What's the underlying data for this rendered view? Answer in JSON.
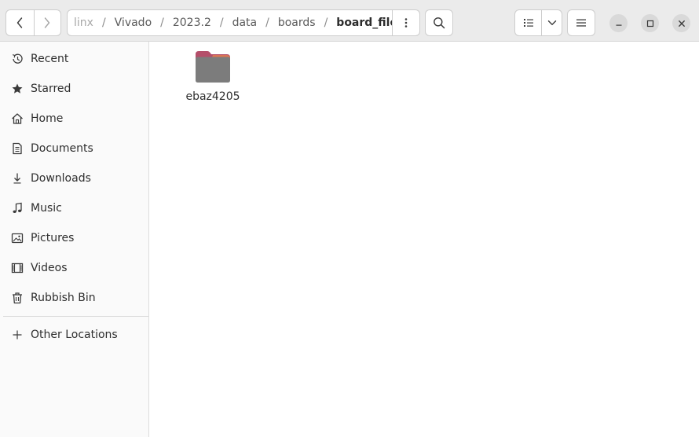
{
  "toolbar": {
    "back_icon": "chevron-left-icon",
    "forward_icon": "chevron-right-icon",
    "search_icon": "search-icon",
    "list_view_icon": "list-view-icon",
    "view_options_icon": "chevron-down-icon",
    "menu_icon": "hamburger-menu-icon",
    "path_menu_icon": "vertical-dots-icon"
  },
  "pathbar": {
    "crumbs": [
      {
        "label": "linx",
        "state": "faded"
      },
      {
        "label": "Vivado",
        "state": "normal"
      },
      {
        "label": "2023.2",
        "state": "normal"
      },
      {
        "label": "data",
        "state": "normal"
      },
      {
        "label": "boards",
        "state": "normal"
      },
      {
        "label": "board_files",
        "state": "current"
      }
    ],
    "separator": "/"
  },
  "window_controls": {
    "minimize_icon": "minimize-icon",
    "maximize_icon": "maximize-icon",
    "close_icon": "close-icon"
  },
  "sidebar": {
    "items": [
      {
        "label": "Recent",
        "icon": "clock-icon"
      },
      {
        "label": "Starred",
        "icon": "star-icon"
      },
      {
        "label": "Home",
        "icon": "home-icon"
      },
      {
        "label": "Documents",
        "icon": "document-icon"
      },
      {
        "label": "Downloads",
        "icon": "download-icon"
      },
      {
        "label": "Music",
        "icon": "music-note-icon"
      },
      {
        "label": "Pictures",
        "icon": "picture-icon"
      },
      {
        "label": "Videos",
        "icon": "film-icon"
      },
      {
        "label": "Rubbish Bin",
        "icon": "trash-icon"
      }
    ],
    "other_locations": {
      "label": "Other Locations",
      "icon": "plus-icon"
    }
  },
  "main": {
    "files": [
      {
        "name": "ebaz4205",
        "type": "folder",
        "icon": "folder-icon"
      }
    ]
  },
  "colors": {
    "folder_back": "#b44f6a",
    "folder_tab_accent": "#e07a4f",
    "folder_front": "#7c7c7c",
    "header_bg": "#ebebeb",
    "sidebar_bg": "#fafafa"
  }
}
